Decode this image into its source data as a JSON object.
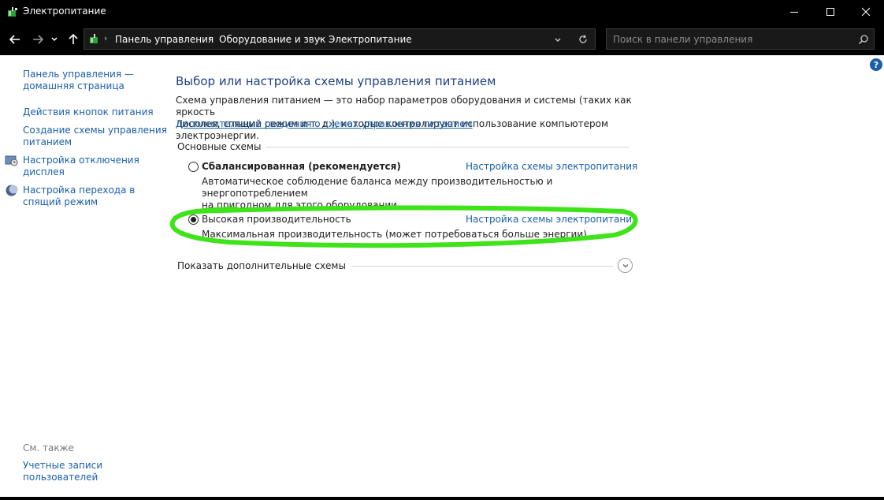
{
  "window": {
    "title": "Электропитание"
  },
  "address": {
    "breadcrumbs": [
      "Панель управления",
      "Оборудование и звук",
      "Электропитание"
    ],
    "search_placeholder": "Поиск в панели управления"
  },
  "sidebar": {
    "home_line1": "Панель управления —",
    "home_line2": "домашняя страница",
    "items": [
      {
        "lines": [
          "Действия кнопок питания"
        ]
      },
      {
        "lines": [
          "Создание схемы управления",
          "питанием"
        ]
      },
      {
        "lines": [
          "Настройка отключения",
          "дисплея"
        ]
      },
      {
        "lines": [
          "Настройка перехода в",
          "спящий режим"
        ]
      }
    ],
    "see_also_label": "См. также",
    "see_also_items": [
      {
        "lines": [
          "Учетные записи",
          "пользователей"
        ]
      }
    ]
  },
  "main": {
    "title": "Выбор или настройка схемы управления питанием",
    "description_line1": "Схема управления питанием — это набор параметров оборудования и системы (таких как яркость",
    "description_line2": "дисплея, спящий режим и т. д.), которые контролируют использование компьютером электроэнергии.",
    "description_link": "Дополнительные сведения о схемах управления питанием",
    "section_label": "Основные схемы",
    "plans": [
      {
        "name": "Сбалансированная (рекомендуется)",
        "selected": false,
        "link": "Настройка схемы электропитания",
        "desc_line1": "Автоматическое соблюдение баланса между производительностью и энергопотреблением",
        "desc_line2": "на пригодном для этого оборудовании."
      },
      {
        "name": "Высокая производительность",
        "selected": true,
        "link": "Настройка схемы электропитания",
        "desc_line1": "Максимальная производительность (может потребоваться больше энергии).",
        "desc_line2": ""
      }
    ],
    "more_label": "Показать дополнительные схемы"
  },
  "colors": {
    "link": "#1a5fa8",
    "title": "#1e3f80",
    "highlight": "#3ee31a",
    "chrome": "#000000"
  }
}
